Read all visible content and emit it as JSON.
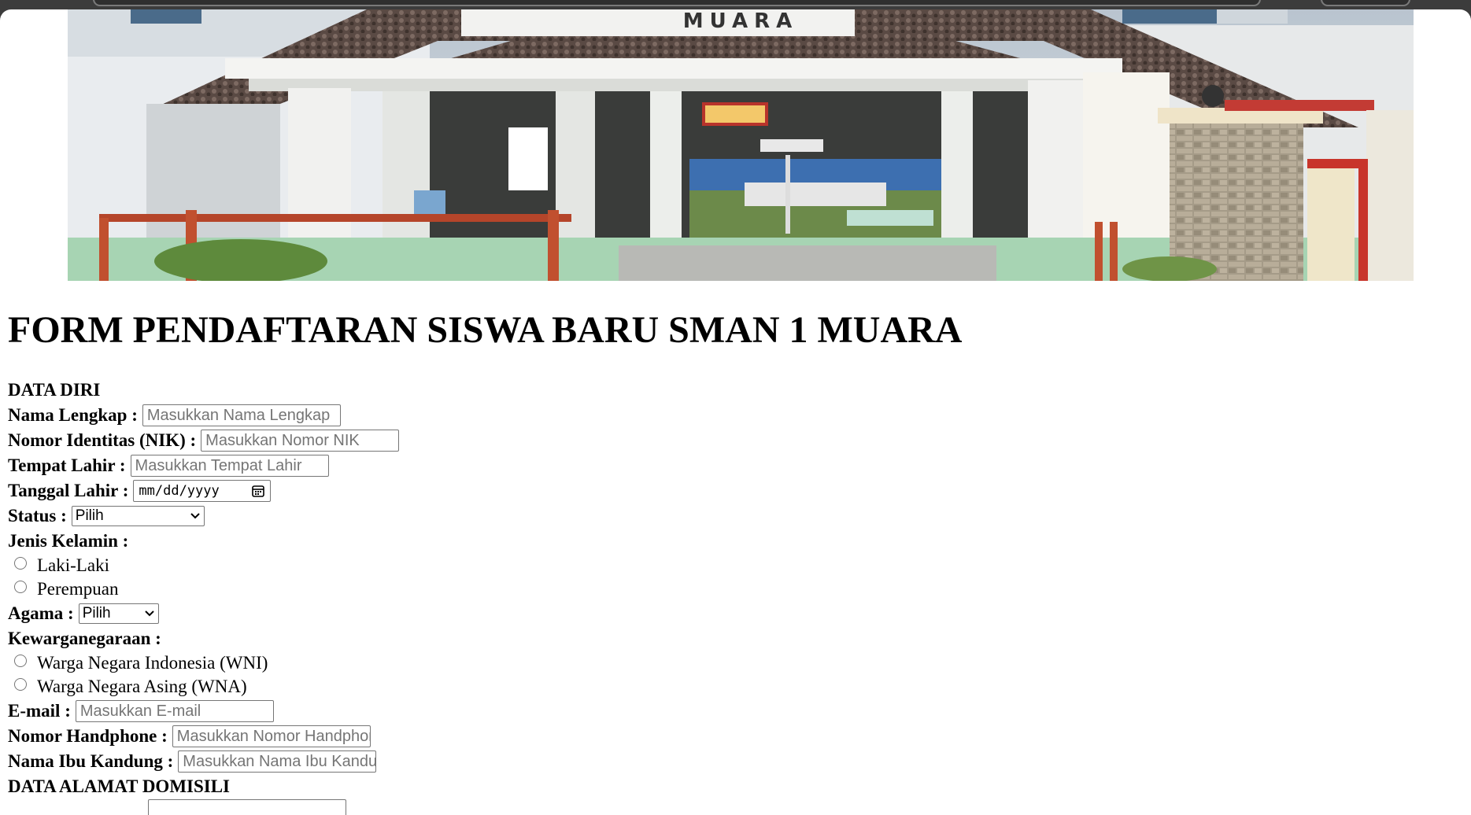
{
  "banner": {
    "sign_text": "MUARA"
  },
  "page_title": "FORM PENDAFTARAN SISWA BARU SMAN 1 MUARA",
  "sections": {
    "data_diri": "DATA DIRI",
    "data_alamat": "DATA ALAMAT DOMISILI"
  },
  "fields": {
    "nama_lengkap": {
      "label": "Nama Lengkap :",
      "placeholder": "Masukkan Nama Lengkap"
    },
    "nik": {
      "label": "Nomor Identitas (NIK) :",
      "placeholder": "Masukkan Nomor NIK"
    },
    "tempat_lahir": {
      "label": "Tempat Lahir :",
      "placeholder": "Masukkan Tempat Lahir"
    },
    "tanggal_lahir": {
      "label": "Tanggal Lahir :",
      "value": "mm/dd/yyyy"
    },
    "status": {
      "label": "Status :",
      "selected": "Pilih"
    },
    "jenis_kelamin": {
      "label": "Jenis Kelamin :",
      "options": [
        "Laki-Laki",
        "Perempuan"
      ]
    },
    "agama": {
      "label": "Agama :",
      "selected": "Pilih"
    },
    "kewarganegaraan": {
      "label": "Kewarganegaraan :",
      "options": [
        "Warga Negara Indonesia (WNI)",
        "Warga Negara Asing (WNA)"
      ]
    },
    "email": {
      "label": "E-mail :",
      "placeholder": "Masukkan E-mail"
    },
    "handphone": {
      "label": "Nomor Handphone :",
      "placeholder": "Masukkan Nomor Handphone"
    },
    "nama_ibu": {
      "label": "Nama Ibu Kandung :",
      "placeholder": "Masukkan Nama Ibu Kandung"
    }
  },
  "icons": {
    "calendar": "calendar-icon",
    "chevron": "chevron-down-icon"
  }
}
